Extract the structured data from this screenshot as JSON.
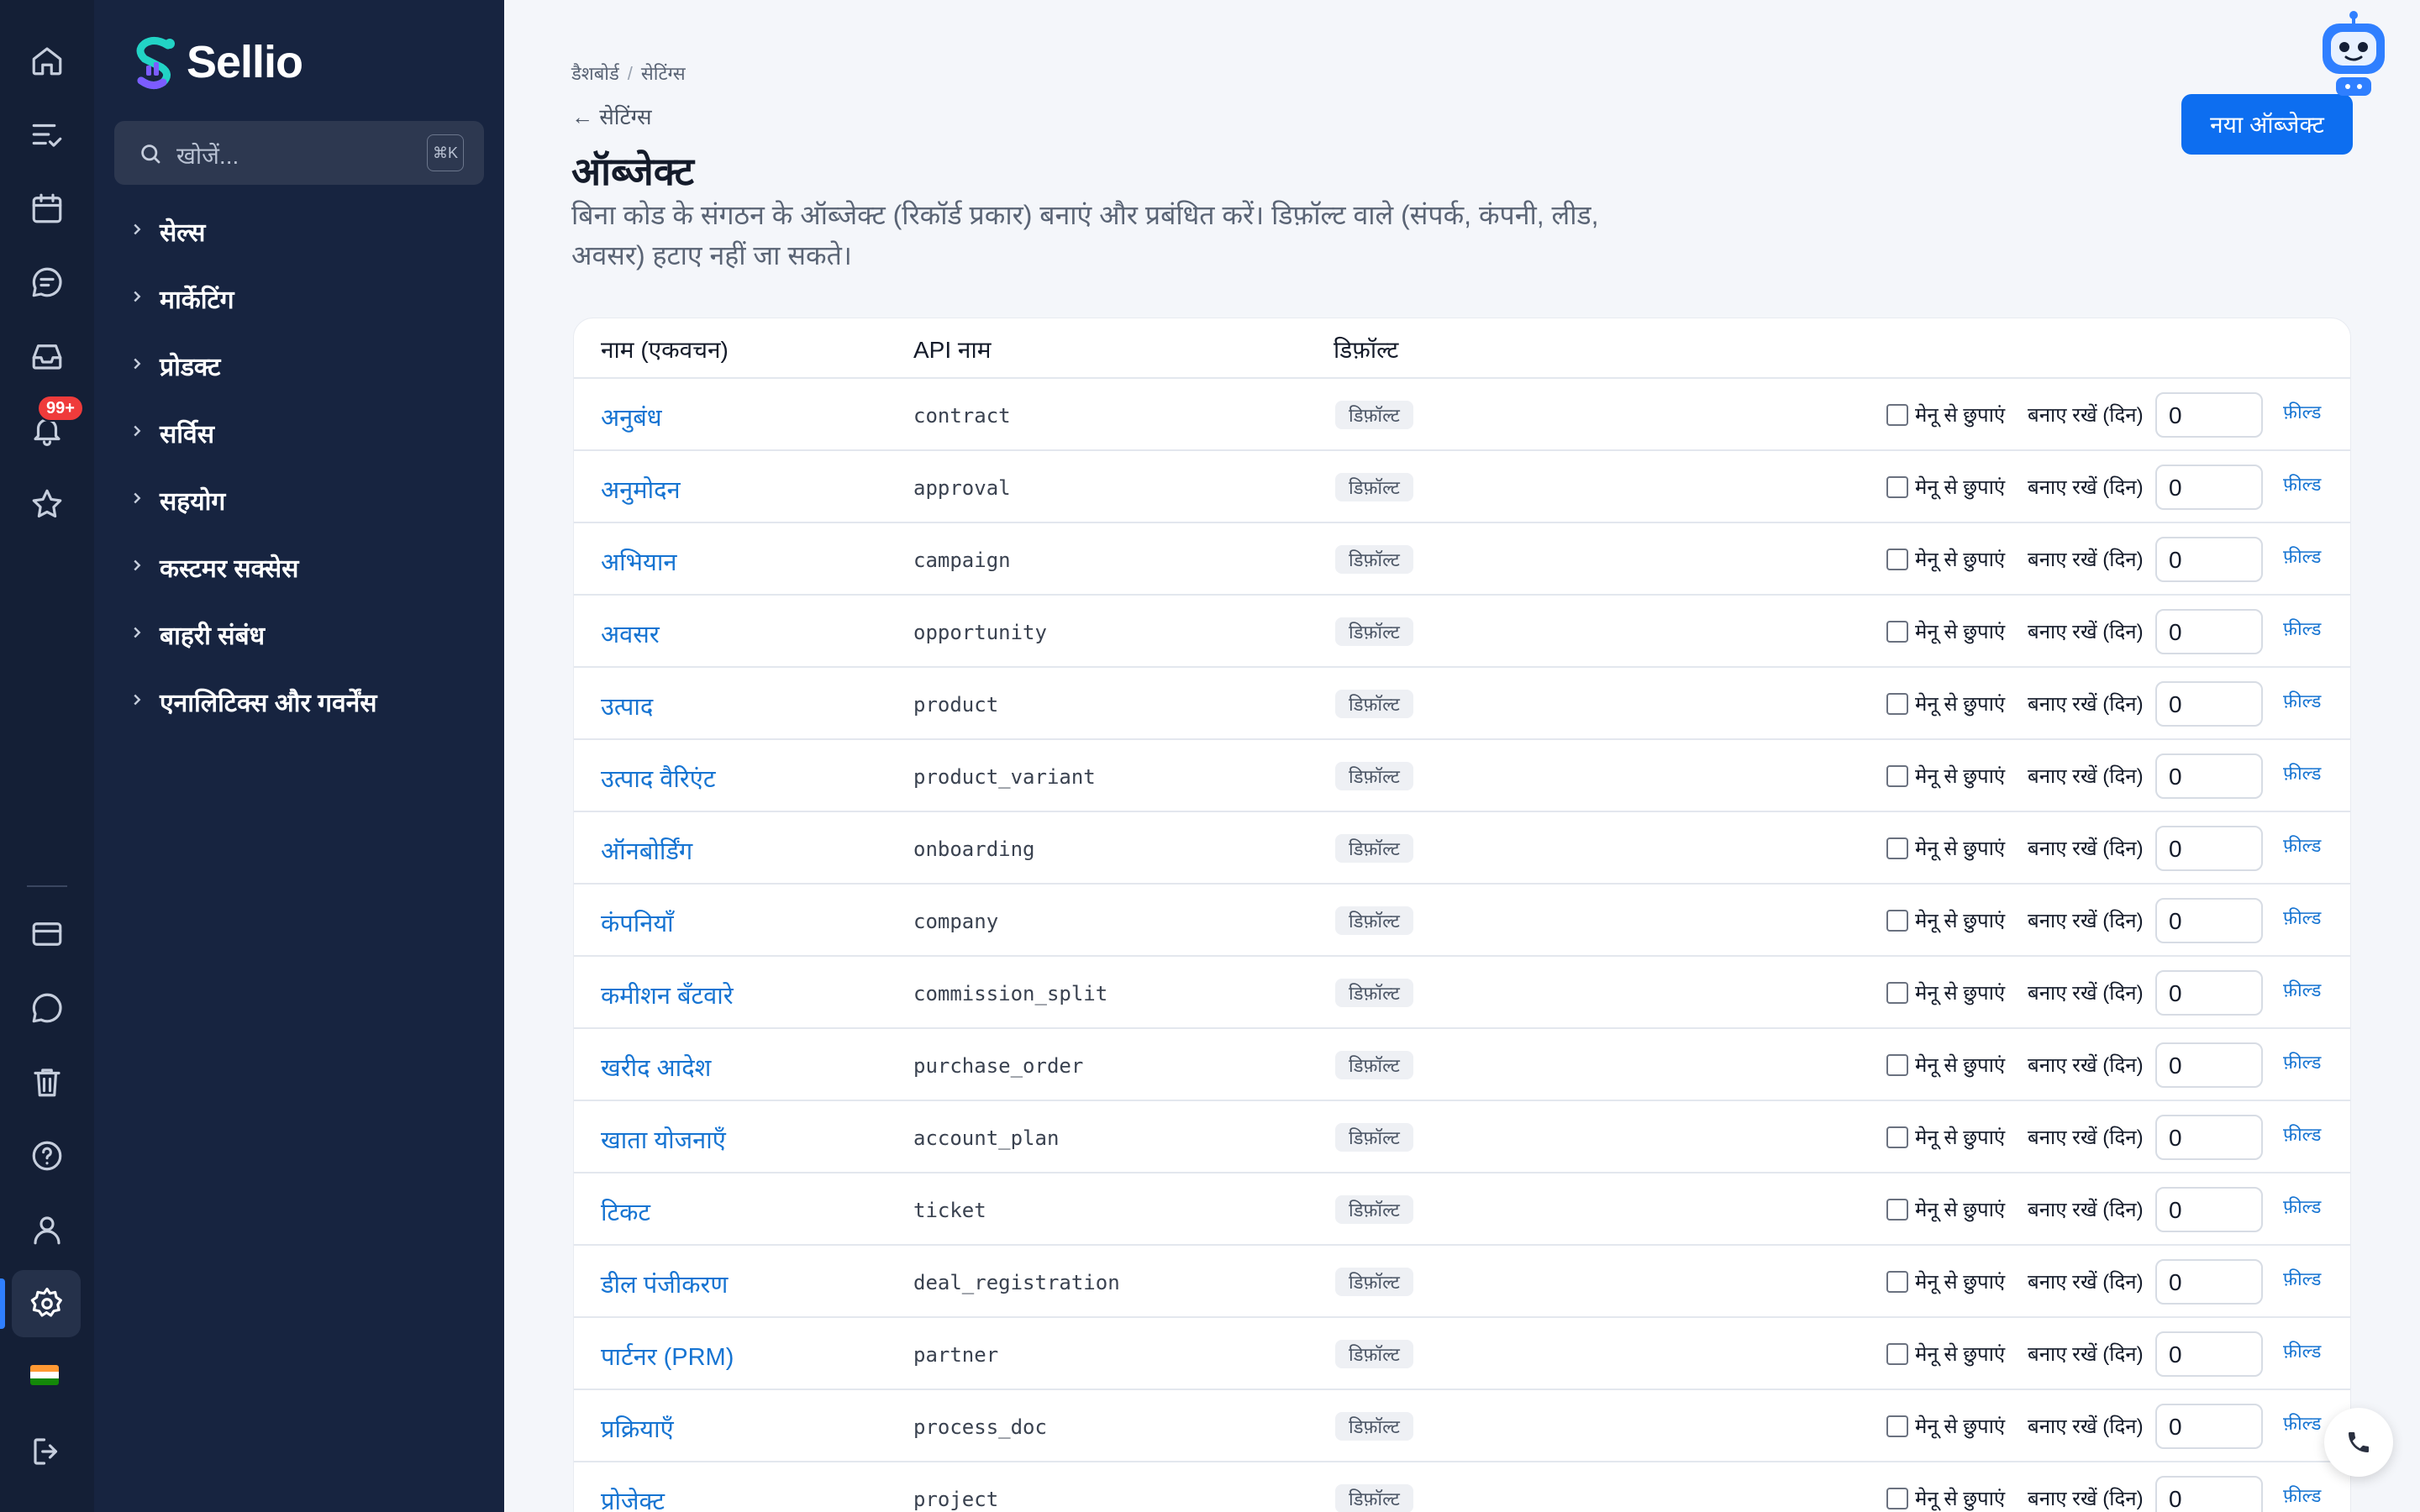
{
  "app": {
    "name": "Sellio",
    "notification_count": "99+"
  },
  "sidebar": {
    "search": {
      "placeholder": "खोजें...",
      "shortcut": "⌘K"
    },
    "items": [
      {
        "label": "सेल्स"
      },
      {
        "label": "मार्केटिंग"
      },
      {
        "label": "प्रोडक्ट"
      },
      {
        "label": "सर्विस"
      },
      {
        "label": "सहयोग"
      },
      {
        "label": "कस्टमर सक्सेस"
      },
      {
        "label": "बाहरी संबंध"
      },
      {
        "label": "एनालिटिक्स और गवर्नेंस"
      }
    ]
  },
  "rail_icons": [
    "home-icon",
    "tasks-icon",
    "calendar-icon",
    "chat-icon",
    "inbox-icon",
    "bell-icon",
    "star-icon",
    "card-icon",
    "message-icon",
    "trash-icon",
    "help-icon",
    "user-icon",
    "settings-icon",
    "flag-icon",
    "logout-icon"
  ],
  "header": {
    "breadcrumb": [
      "डैशबोर्ड",
      "सेटिंग्स"
    ],
    "back_label": "← सेटिंग्स",
    "title": "ऑब्जेक्ट",
    "description": "बिना कोड के संगठन के ऑब्जेक्ट (रिकॉर्ड प्रकार) बनाएं और प्रबंधित करें। डिफ़ॉल्ट वाले (संपर्क, कंपनी, लीड, अवसर) हटाए नहीं जा सकते।",
    "new_button": "नया ऑब्जेक्ट"
  },
  "table": {
    "columns": [
      "नाम (एकवचन)",
      "API नाम",
      "डिफ़ॉल्ट"
    ],
    "default_badge": "डिफ़ॉल्ट",
    "hide_label": "मेनू से छुपाएं",
    "retain_label": "बनाए रखें (दिन)",
    "fields_link": "फ़ील्ड",
    "rows": [
      {
        "name": "अनुबंध",
        "api": "contract",
        "days": "0"
      },
      {
        "name": "अनुमोदन",
        "api": "approval",
        "days": "0"
      },
      {
        "name": "अभियान",
        "api": "campaign",
        "days": "0"
      },
      {
        "name": "अवसर",
        "api": "opportunity",
        "days": "0"
      },
      {
        "name": "उत्पाद",
        "api": "product",
        "days": "0"
      },
      {
        "name": "उत्पाद वैरिएंट",
        "api": "product_variant",
        "days": "0"
      },
      {
        "name": "ऑनबोर्डिंग",
        "api": "onboarding",
        "days": "0"
      },
      {
        "name": "कंपनियाँ",
        "api": "company",
        "days": "0"
      },
      {
        "name": "कमीशन बँटवारे",
        "api": "commission_split",
        "days": "0"
      },
      {
        "name": "खरीद आदेश",
        "api": "purchase_order",
        "days": "0"
      },
      {
        "name": "खाता योजनाएँ",
        "api": "account_plan",
        "days": "0"
      },
      {
        "name": "टिकट",
        "api": "ticket",
        "days": "0"
      },
      {
        "name": "डील पंजीकरण",
        "api": "deal_registration",
        "days": "0"
      },
      {
        "name": "पार्टनर (PRM)",
        "api": "partner",
        "days": "0"
      },
      {
        "name": "प्रक्रियाएँ",
        "api": "process_doc",
        "days": "0"
      },
      {
        "name": "प्रोजेक्ट",
        "api": "project",
        "days": "0"
      }
    ]
  }
}
